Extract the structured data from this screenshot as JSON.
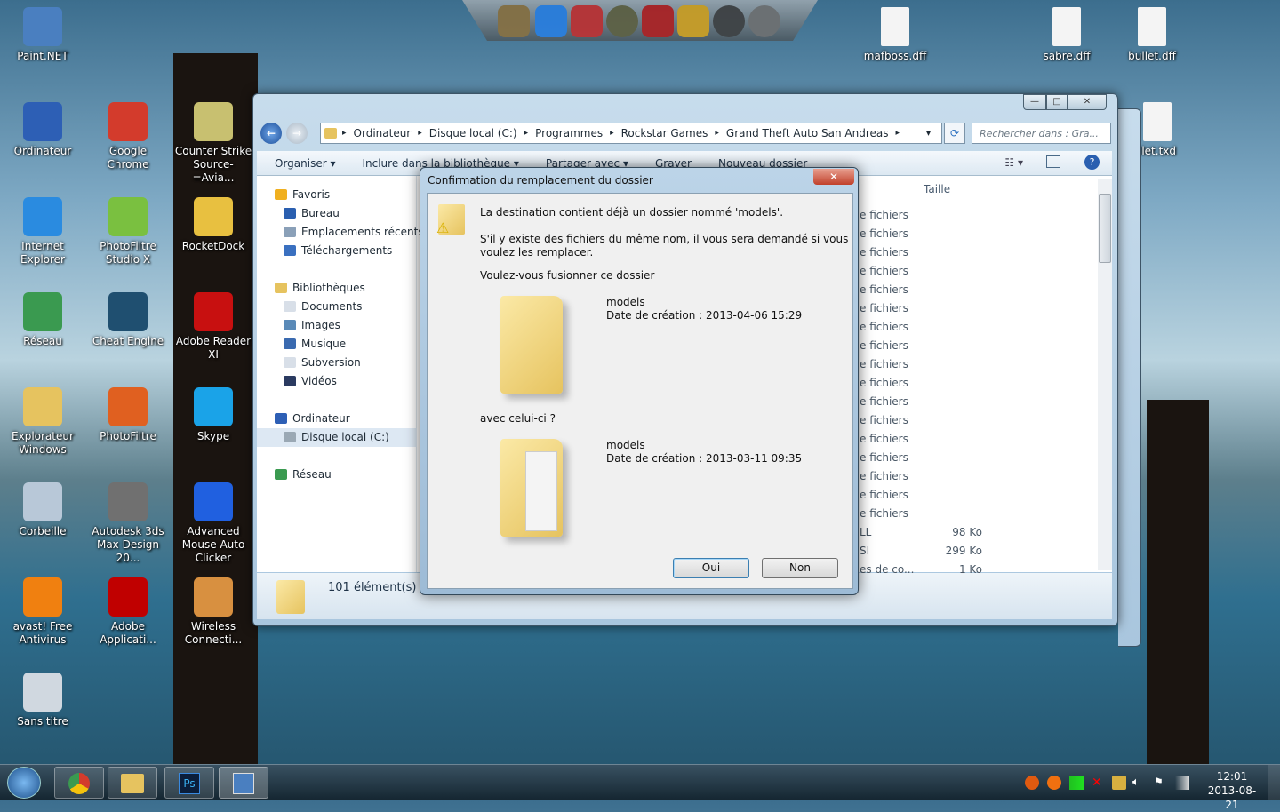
{
  "desktop_icons": [
    {
      "label": "Paint.NET",
      "col": 0,
      "row": 0,
      "color": "#4a7fc0"
    },
    {
      "label": "Ordinateur",
      "col": 0,
      "row": 1,
      "color": "#2d5fb5"
    },
    {
      "label": "Google Chrome",
      "col": 1,
      "row": 1,
      "color": "#d33b2c"
    },
    {
      "label": "Counter Strike Source-=Avia...",
      "col": 2,
      "row": 1,
      "color": "#c8c070"
    },
    {
      "label": "Internet Explorer",
      "col": 0,
      "row": 2,
      "color": "#2a8be0"
    },
    {
      "label": "PhotoFiltre Studio X",
      "col": 1,
      "row": 2,
      "color": "#7ac040"
    },
    {
      "label": "RocketDock",
      "col": 2,
      "row": 2,
      "color": "#e8c040"
    },
    {
      "label": "Réseau",
      "col": 0,
      "row": 3,
      "color": "#3a9a50"
    },
    {
      "label": "Cheat Engine",
      "col": 1,
      "row": 3,
      "color": "#1f4f70"
    },
    {
      "label": "Adobe Reader XI",
      "col": 2,
      "row": 3,
      "color": "#c81010"
    },
    {
      "label": "Explorateur Windows",
      "col": 0,
      "row": 4,
      "color": "#e6c35f"
    },
    {
      "label": "PhotoFiltre",
      "col": 1,
      "row": 4,
      "color": "#e06020"
    },
    {
      "label": "Skype",
      "col": 2,
      "row": 4,
      "color": "#1aa3e8"
    },
    {
      "label": "Corbeille",
      "col": 0,
      "row": 5,
      "color": "#b8c8d8"
    },
    {
      "label": "Autodesk 3ds Max Design 20...",
      "col": 1,
      "row": 5,
      "color": "#707070"
    },
    {
      "label": "Advanced Mouse Auto Clicker",
      "col": 2,
      "row": 5,
      "color": "#2060e0"
    },
    {
      "label": "avast! Free Antivirus",
      "col": 0,
      "row": 6,
      "color": "#f08010"
    },
    {
      "label": "Adobe Applicati...",
      "col": 1,
      "row": 6,
      "color": "#c00000"
    },
    {
      "label": "Wireless Connecti...",
      "col": 2,
      "row": 6,
      "color": "#d89040"
    },
    {
      "label": "Sans titre",
      "col": 0,
      "row": 7,
      "color": "#d0d8e0"
    }
  ],
  "right_icons": [
    {
      "label": "mafboss.dff"
    },
    {
      "label": "sabre.dff"
    },
    {
      "label": "bullet.dff"
    },
    {
      "label": "llet.txd"
    }
  ],
  "explorer": {
    "breadcrumb": [
      "Ordinateur",
      "Disque local (C:)",
      "Programmes",
      "Rockstar Games",
      "Grand Theft Auto San Andreas"
    ],
    "search_placeholder": "Rechercher dans : Gra...",
    "toolbar": [
      "Organiser ▾",
      "Inclure dans la bibliothèque ▾",
      "Partager avec ▾",
      "Graver",
      "Nouveau dossier"
    ],
    "nav": {
      "favoris": "Favoris",
      "bureau": "Bureau",
      "recents": "Emplacements récents",
      "telechargements": "Téléchargements",
      "bibliotheques": "Bibliothèques",
      "documents": "Documents",
      "images": "Images",
      "musique": "Musique",
      "subversion": "Subversion",
      "videos": "Vidéos",
      "ordinateur": "Ordinateur",
      "disque": "Disque local (C:)",
      "reseau": "Réseau"
    },
    "column_taille": "Taille",
    "rows": [
      {
        "type": "e fichiers",
        "size": ""
      },
      {
        "type": "e fichiers",
        "size": ""
      },
      {
        "type": "e fichiers",
        "size": ""
      },
      {
        "type": "e fichiers",
        "size": ""
      },
      {
        "type": "e fichiers",
        "size": ""
      },
      {
        "type": "e fichiers",
        "size": ""
      },
      {
        "type": "e fichiers",
        "size": ""
      },
      {
        "type": "e fichiers",
        "size": ""
      },
      {
        "type": "e fichiers",
        "size": ""
      },
      {
        "type": "e fichiers",
        "size": ""
      },
      {
        "type": "e fichiers",
        "size": ""
      },
      {
        "type": "e fichiers",
        "size": ""
      },
      {
        "type": "e fichiers",
        "size": ""
      },
      {
        "type": "e fichiers",
        "size": ""
      },
      {
        "type": "e fichiers",
        "size": ""
      },
      {
        "type": "e fichiers",
        "size": ""
      },
      {
        "type": "e fichiers",
        "size": ""
      },
      {
        "type": "LL",
        "size": "98 Ko"
      },
      {
        "type": "SI",
        "size": "299 Ko"
      },
      {
        "type": "es de co...",
        "size": "1 Ko"
      }
    ],
    "status": "101 élément(s)"
  },
  "dialog": {
    "title": "Confirmation du remplacement du dossier",
    "line1": "La destination contient déjà un dossier nommé 'models'.",
    "line2": "S'il y existe des fichiers du même nom, il vous sera demandé si vous voulez les remplacer.",
    "line3": "Voulez-vous fusionner ce dossier",
    "dest_name": "models",
    "dest_date": "Date de création : 2013-04-06 15:29",
    "with": "avec celui-ci ?",
    "src_name": "models",
    "src_date": "Date de création : 2013-03-11 09:35",
    "yes": "Oui",
    "no": "Non"
  },
  "tray": {
    "time": "12:01",
    "date": "2013-08-21"
  }
}
